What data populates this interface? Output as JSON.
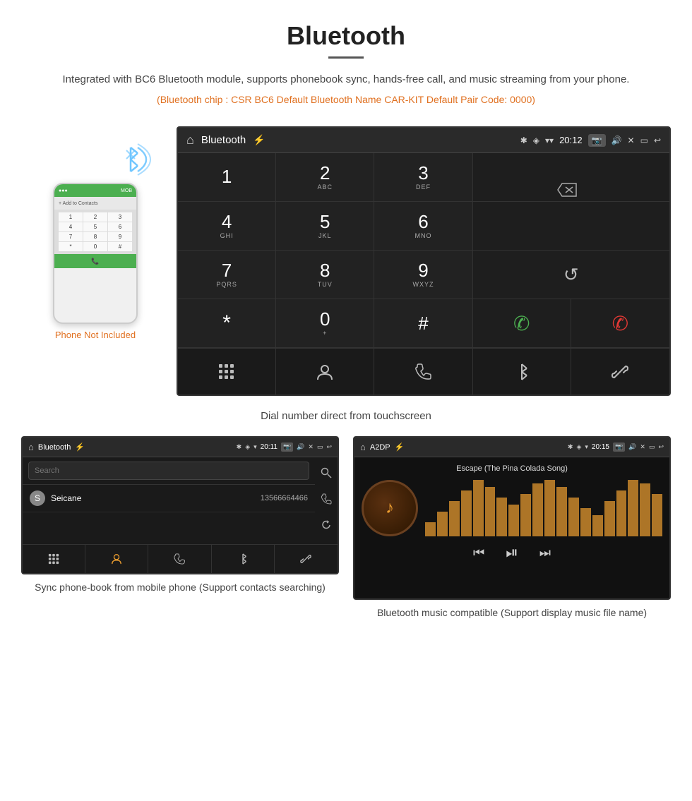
{
  "page": {
    "title": "Bluetooth",
    "description": "Integrated with BC6 Bluetooth module, supports phonebook sync, hands-free call, and music streaming from your phone.",
    "specs": "(Bluetooth chip : CSR BC6    Default Bluetooth Name CAR-KIT    Default Pair Code: 0000)",
    "dial_caption": "Dial number direct from touchscreen",
    "phonebook_caption": "Sync phone-book from mobile phone\n(Support contacts searching)",
    "music_caption": "Bluetooth music compatible\n(Support display music file name)",
    "phone_not_included": "Phone Not Included"
  },
  "car_screen": {
    "status": {
      "title": "Bluetooth",
      "usb_symbol": "⌨",
      "bt_symbol": "✱",
      "location": "◉",
      "signal": "▾",
      "wifi": "▾",
      "time": "20:12",
      "camera_icon": "📷",
      "vol_icon": "🔊",
      "close_icon": "✕",
      "rect_icon": "▭",
      "back_icon": "↩"
    },
    "dialpad": {
      "keys": [
        {
          "num": "1",
          "sub": ""
        },
        {
          "num": "2",
          "sub": "ABC"
        },
        {
          "num": "3",
          "sub": "DEF"
        },
        {
          "num": "4",
          "sub": "GHI"
        },
        {
          "num": "5",
          "sub": "JKL"
        },
        {
          "num": "6",
          "sub": "MNO"
        },
        {
          "num": "7",
          "sub": "PQRS"
        },
        {
          "num": "8",
          "sub": "TUV"
        },
        {
          "num": "9",
          "sub": "WXYZ"
        },
        {
          "num": "*",
          "sub": ""
        },
        {
          "num": "0",
          "sub": "+"
        },
        {
          "num": "#",
          "sub": ""
        }
      ]
    },
    "bottom_nav": [
      "⋮⋮⋮",
      "👤",
      "☏",
      "✱",
      "🔗"
    ]
  },
  "phonebook_screen": {
    "status": {
      "title": "Bluetooth",
      "usb_symbol": "⌨",
      "time": "20:11"
    },
    "search_placeholder": "Search",
    "contacts": [
      {
        "initial": "S",
        "name": "Seicane",
        "phone": "13566664466"
      }
    ],
    "bottom_nav": [
      "⋮⋮⋮",
      "👤",
      "☏",
      "✱",
      "🔗"
    ]
  },
  "music_screen": {
    "status": {
      "title": "A2DP",
      "usb_symbol": "⌨",
      "time": "20:15"
    },
    "song_title": "Escape (The Pina Colada Song)",
    "viz_bars": [
      20,
      35,
      50,
      65,
      80,
      70,
      55,
      45,
      60,
      75,
      85,
      70,
      55,
      40,
      30,
      50,
      65,
      80,
      75,
      60
    ],
    "controls": [
      "⏮",
      "⏯",
      "⏭"
    ]
  },
  "phone_mock": {
    "top_bar_text": "MOB",
    "contacts_label": "+ Add to Contacts",
    "keys": [
      "1",
      "2",
      "3",
      "4",
      "5",
      "6",
      "7",
      "8",
      "9",
      "*",
      "0",
      "#"
    ],
    "call_btn": "📞"
  }
}
